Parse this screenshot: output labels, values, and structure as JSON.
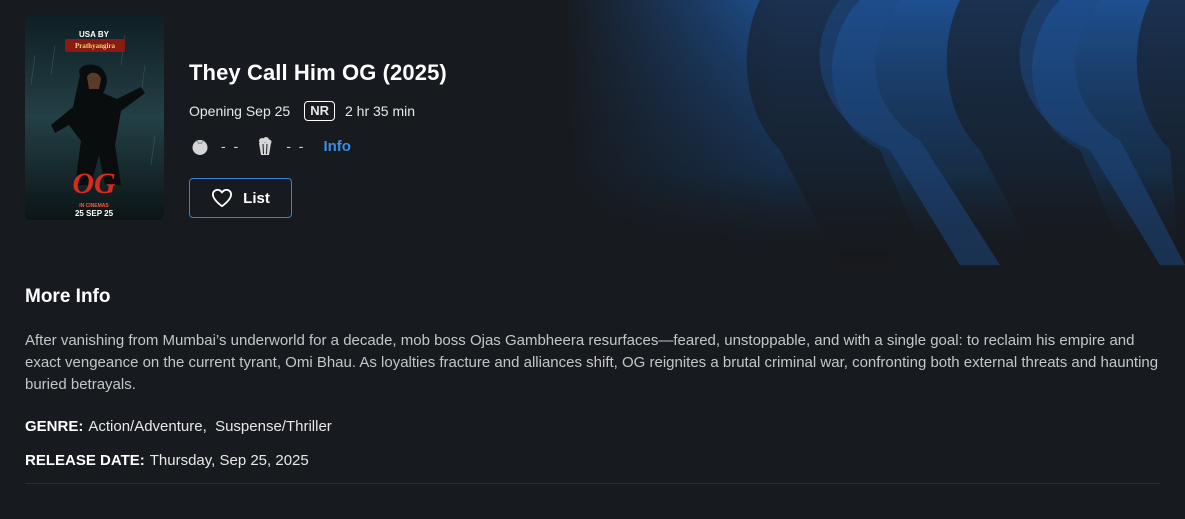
{
  "movie": {
    "title": "They Call Him OG (2025)",
    "opening": "Opening Sep 25",
    "rating": "NR",
    "runtime": "2 hr 35 min"
  },
  "scores": {
    "tomatometer": "- -",
    "popcornmeter": "- -",
    "info_label": "Info"
  },
  "actions": {
    "list_label": "List"
  },
  "poster": {
    "top_text": "USA BY",
    "logo_text": "Prathyangira",
    "title_text": "OG",
    "release_text": "25 SEP 25",
    "in_cinemas": "IN CINEMAS",
    "icon": "movie-poster"
  },
  "more_info": {
    "heading": "More Info",
    "description": "After vanishing from Mumbai’s underworld for a decade, mob boss Ojas Gambheera resurfaces—feared, unstoppable, and with a single goal: to reclaim his empire and exact vengeance on the current tyrant, Omi Bhau. As loyalties fracture and alliances shift, OG reignites a brutal criminal war, confronting both external threats and haunting buried betrayals.",
    "genre_label": "GENRE:",
    "genre_value": "Action/Adventure,  Suspense/Thriller",
    "release_label": "RELEASE DATE:",
    "release_value": "Thursday, Sep 25, 2025"
  },
  "colors": {
    "background": "#171a1e",
    "accent_blue": "#3a8ee6",
    "button_border": "#3a7ed8"
  }
}
